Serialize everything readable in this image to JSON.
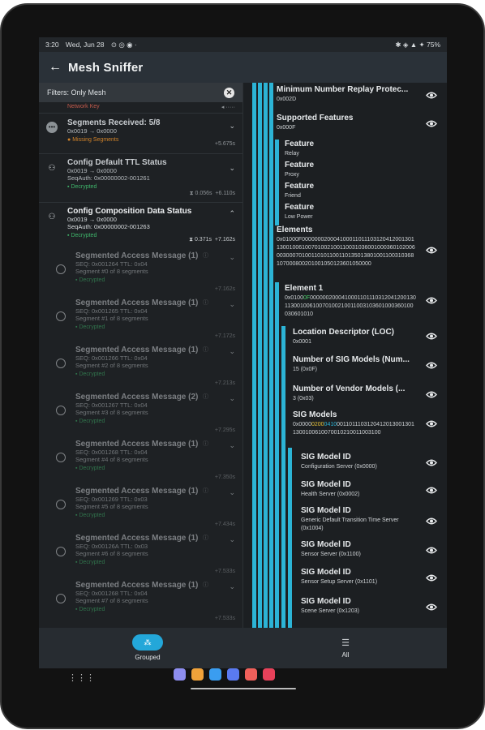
{
  "status": {
    "time": "3:20",
    "date": "Wed, Jun 28",
    "battery": "75%"
  },
  "appbar": {
    "back_glyph": "←",
    "title": "Mesh Sniffer"
  },
  "filter": {
    "label": "Filters: Only Mesh"
  },
  "packets": [
    {
      "title": "Network Key",
      "sub1": "",
      "sub2": "",
      "status": "",
      "meta": ""
    },
    {
      "title": "Segments Received: 5/8",
      "sub1": "0x0019 → 0x0000",
      "sub2": "",
      "status": "Missing Segments",
      "meta": "+5.675s"
    },
    {
      "title": "Config Default TTL Status",
      "sub1": "0x0019 → 0x0000",
      "sub2": "SeqAuth: 0x00000002-001261",
      "status": "Decrypted",
      "meta": "+6.110s",
      "meta2": "0.056s"
    },
    {
      "title": "Config Composition Data Status",
      "sub1": "0x0019 → 0x0000",
      "sub2": "SeqAuth: 0x00000002-001263",
      "status": "Decrypted",
      "meta": "+7.162s",
      "meta2": "0.371s"
    }
  ],
  "segments": [
    {
      "title": "Segmented Access Message",
      "count": "(1)",
      "seq": "SEQ: 0x001264 TTL: 0x04",
      "seg": "Segment #0 of 8 segments",
      "status": "Decrypted",
      "meta": "+7.162s"
    },
    {
      "title": "Segmented Access Message",
      "count": "(1)",
      "seq": "SEQ: 0x001265 TTL: 0x04",
      "seg": "Segment #1 of 8 segments",
      "status": "Decrypted",
      "meta": "+7.172s"
    },
    {
      "title": "Segmented Access Message",
      "count": "(1)",
      "seq": "SEQ: 0x001266 TTL: 0x04",
      "seg": "Segment #2 of 8 segments",
      "status": "Decrypted",
      "meta": "+7.213s"
    },
    {
      "title": "Segmented Access Message",
      "count": "(2)",
      "seq": "SEQ: 0x001267 TTL: 0x04",
      "seg": "Segment #3 of 8 segments",
      "status": "Decrypted",
      "meta": "+7.295s"
    },
    {
      "title": "Segmented Access Message",
      "count": "(1)",
      "seq": "SEQ: 0x001268 TTL: 0x04",
      "seg": "Segment #4 of 8 segments",
      "status": "Decrypted",
      "meta": "+7.350s"
    },
    {
      "title": "Segmented Access Message",
      "count": "(1)",
      "seq": "SEQ: 0x001269 TTL: 0x03",
      "seg": "Segment #5 of 8 segments",
      "status": "Decrypted",
      "meta": "+7.434s"
    },
    {
      "title": "Segmented Access Message",
      "count": "(1)",
      "seq": "SEQ: 0x00126A TTL: 0x03",
      "seg": "Segment #6 of 8 segments",
      "status": "Decrypted",
      "meta": "+7.533s"
    },
    {
      "title": "Segmented Access Message",
      "count": "(1)",
      "seq": "SEQ: 0x001268 TTL: 0x04",
      "seg": "Segment #7 of 8 segments",
      "status": "Decrypted",
      "meta": "+7.533s"
    }
  ],
  "details": {
    "mnrp": {
      "title": "Minimum Number Replay Protec...",
      "value": "0x002D"
    },
    "features": {
      "title": "Supported Features",
      "value": "0x000F"
    },
    "f_relay": {
      "title": "Feature",
      "value": "Relay"
    },
    "f_proxy": {
      "title": "Feature",
      "value": "Proxy"
    },
    "f_friend": {
      "title": "Feature",
      "value": "Friend"
    },
    "f_lowpower": {
      "title": "Feature",
      "value": "Low Power"
    },
    "elements": {
      "title": "Elements",
      "value": "0x01000F0000000200041000110111031204120013011300100610070100210011003103600100036010200600300070100110101100110135013801001100310368107000800201001050123601050000"
    },
    "element1": {
      "title": "Element 1",
      "v1": "0x0100",
      "v2": "0F",
      "v3": "000000200041000110111031204120013011300100610070100210011003103601000360100030601010"
    },
    "loc": {
      "title": "Location Descriptor (LOC)",
      "value": "0x0001"
    },
    "numsig": {
      "title": "Number of SIG Models (Num...",
      "value": "15 (0x0F)"
    },
    "numvendor": {
      "title": "Number of Vendor Models (...",
      "value": "3 (0x03)"
    },
    "sigmodels": {
      "title": "SIG Models",
      "v1": "0x0000",
      "v2": "0200",
      "v3": "0410",
      "v4": "00110111031204120130013011300100610070010210011003100"
    },
    "m1": {
      "title": "SIG Model ID",
      "value": "Configuration Server (0x0000)"
    },
    "m2": {
      "title": "SIG Model ID",
      "value": "Health Server (0x0002)"
    },
    "m3": {
      "title": "SIG Model ID",
      "value": "Generic Default Transition Time Server (0x1004)"
    },
    "m4": {
      "title": "SIG Model ID",
      "value": "Sensor Server (0x1100)"
    },
    "m5": {
      "title": "SIG Model ID",
      "value": "Sensor Setup Server (0x1101)"
    },
    "m6": {
      "title": "SIG Model ID",
      "value": "Scene Server (0x1203)"
    }
  },
  "bottom": {
    "grouped": "Grouped",
    "all": "All"
  },
  "colors": {
    "accent": "#2cb4d6",
    "decrypted": "#3fb56b",
    "missing": "#d1832a",
    "highlight_yellow": "#e5c23a"
  }
}
